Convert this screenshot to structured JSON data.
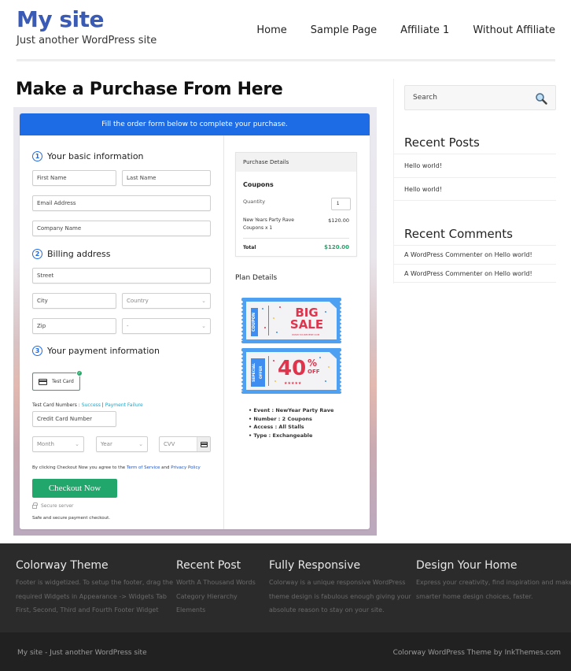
{
  "site": {
    "title": "My site",
    "tagline": "Just another WordPress site"
  },
  "nav": {
    "items": [
      {
        "label": "Home"
      },
      {
        "label": "Sample Page"
      },
      {
        "label": "Affiliate 1"
      },
      {
        "label": "Without Affiliate"
      }
    ]
  },
  "page": {
    "title": "Make a Purchase From Here"
  },
  "checkout": {
    "banner": "Fill the order form below to complete your purchase.",
    "sections": {
      "basic": {
        "num": "1",
        "label": "Your basic information"
      },
      "billing": {
        "num": "2",
        "label": "Billing address"
      },
      "payment": {
        "num": "3",
        "label": "Your payment information"
      }
    },
    "fields": {
      "first_name": "First Name",
      "last_name": "Last Name",
      "email": "Email Address",
      "company": "Company Name",
      "street": "Street",
      "city": "City",
      "country": "Country",
      "zip": "Zip",
      "state": "-",
      "card_number": "Credit Card Number",
      "month": "Month",
      "year": "Year",
      "cvv": "CVV"
    },
    "payment_method": {
      "label": "Test Card",
      "selected": true
    },
    "test_cards": {
      "prefix": "Test Card Numbers : ",
      "success": "Success",
      "separator": " | ",
      "failure": "Payment Failure"
    },
    "terms": {
      "prefix": "By clicking Checkout Now you agree to the ",
      "tos": "Term of Service",
      "and": " and ",
      "privacy": "Privacy Policy"
    },
    "checkout_button": "Checkout Now",
    "secure_label": "Secure server",
    "safe_note": "Safe and secure payment checkout.",
    "purchase_details": {
      "header": "Purchase Details",
      "product": "Coupons",
      "quantity_label": "Quantity",
      "quantity_value": "1",
      "line_item_1": "New Years Party Rave",
      "line_item_2": "Coupons x 1",
      "line_price": "$120.00",
      "total_label": "Total",
      "total_value": "$120.00",
      "total_color": "#21a66b"
    },
    "plan": {
      "title": "Plan Details",
      "coupon1": {
        "tab": "COUPON",
        "line1": "BIG",
        "line2": "SALE",
        "small": "WWW.YOUREVENT.COM"
      },
      "coupon2": {
        "tab": "SEPECIAL OFFER",
        "big": "40",
        "pct": "%",
        "off": "OFF",
        "stars": "★★★★★"
      },
      "items": [
        "Event : NewYear Party Rave",
        "Number : 2 Coupons",
        "Access : All Stalls",
        "Type : Exchangeable"
      ]
    }
  },
  "sidebar": {
    "search_placeholder": "Search",
    "recent_posts_title": "Recent Posts",
    "recent_posts": [
      "Hello world!",
      "Hello world!"
    ],
    "recent_comments_title": "Recent Comments",
    "recent_comments": [
      "A WordPress Commenter on Hello world!",
      "A WordPress Commenter on Hello world!"
    ]
  },
  "footer": {
    "col1": {
      "title": "Colorway Theme",
      "lines": [
        "Footer is widgetized. To setup the footer, drag the",
        "required Widgets in Appearance -> Widgets Tab",
        "First, Second, Third and Fourth Footer Widget"
      ]
    },
    "col2": {
      "title": "Recent Post",
      "links": [
        "Worth A Thousand Words",
        "Category Hierarchy",
        "Elements"
      ]
    },
    "col3": {
      "title": "Fully Responsive",
      "lines": [
        "Colorway is a unique responsive WordPress",
        "theme design is fabulous enough giving your",
        "absolute reason to stay on your site."
      ]
    },
    "col4": {
      "title": "Design Your Home",
      "lines": [
        "Express your creativity, find inspiration and make",
        "smarter home design choices, faster."
      ]
    },
    "bottom_left": "My site - Just another WordPress site",
    "bottom_right": "Colorway WordPress Theme by InkThemes.com"
  },
  "colors": {
    "brand": "#3a5bb5",
    "banner": "#1e6be6",
    "success": "#21a66b",
    "footer_bg": "#2b2b2b"
  }
}
